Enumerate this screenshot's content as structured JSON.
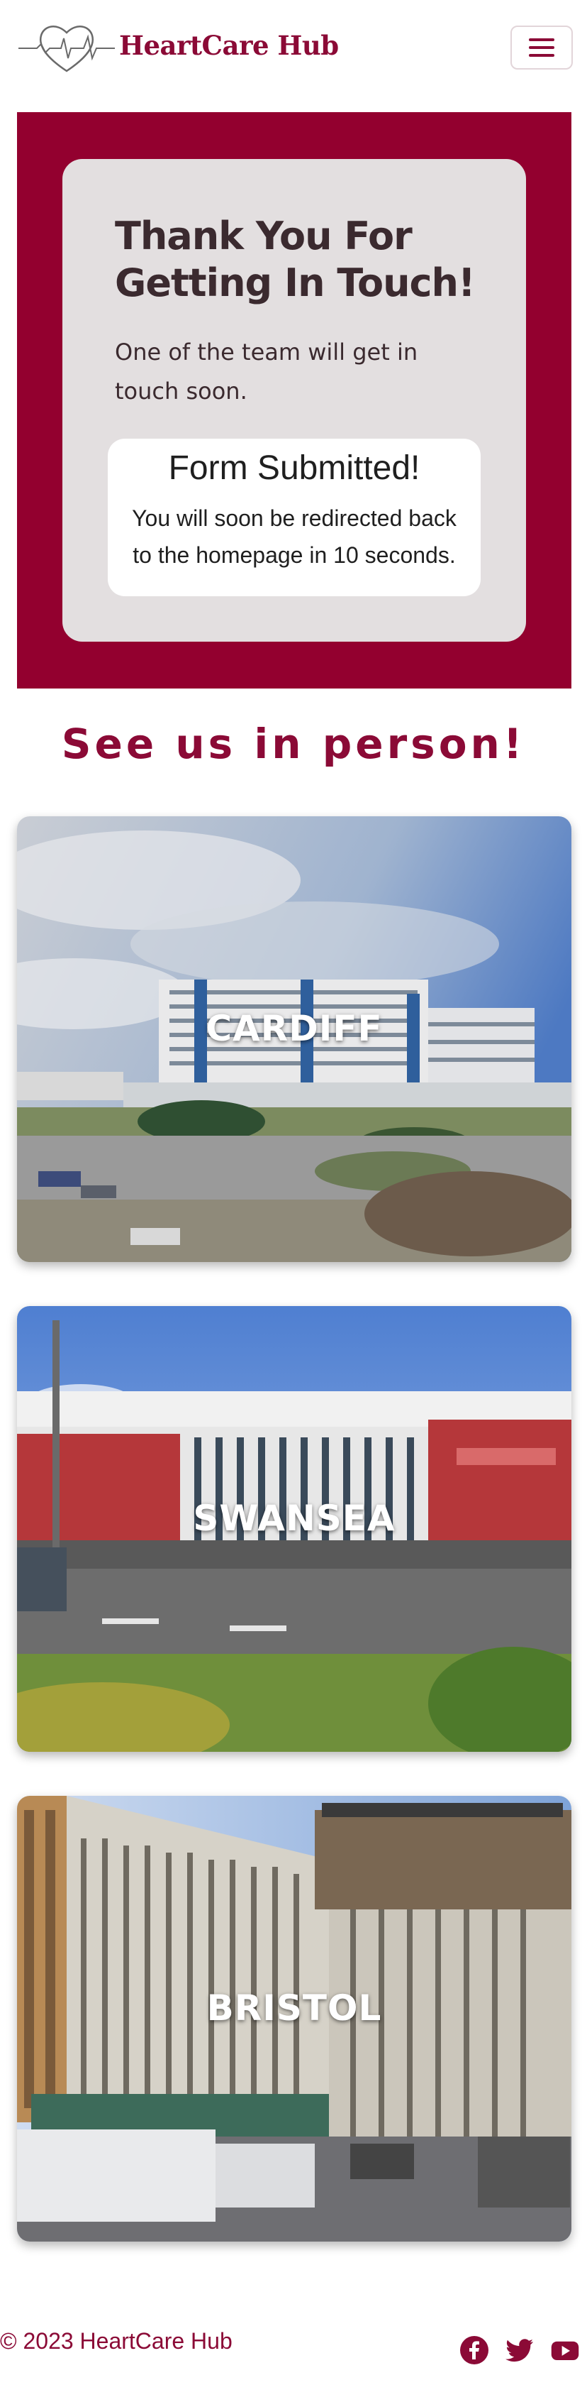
{
  "header": {
    "brand": "HeartCare Hub",
    "menu_icon": "hamburger-menu-icon"
  },
  "hero": {
    "title": "Thank You For Getting In Touch!",
    "subtitle": "One of the team will get in touch soon.",
    "status_title": "Form Submitted!",
    "status_message": "You will soon be redirected back to the homepage in 10 seconds."
  },
  "locations": {
    "heading": "See us in person!",
    "items": [
      {
        "name": "CARDIFF"
      },
      {
        "name": "SWANSEA"
      },
      {
        "name": "BRISTOL"
      }
    ]
  },
  "footer": {
    "copyright": "© 2023 HeartCare Hub",
    "social": [
      "facebook-icon",
      "twitter-icon",
      "youtube-icon"
    ]
  },
  "colors": {
    "brand": "#8b0a36",
    "hero_bg": "#93002f",
    "card_bg": "#e3dfe0"
  }
}
